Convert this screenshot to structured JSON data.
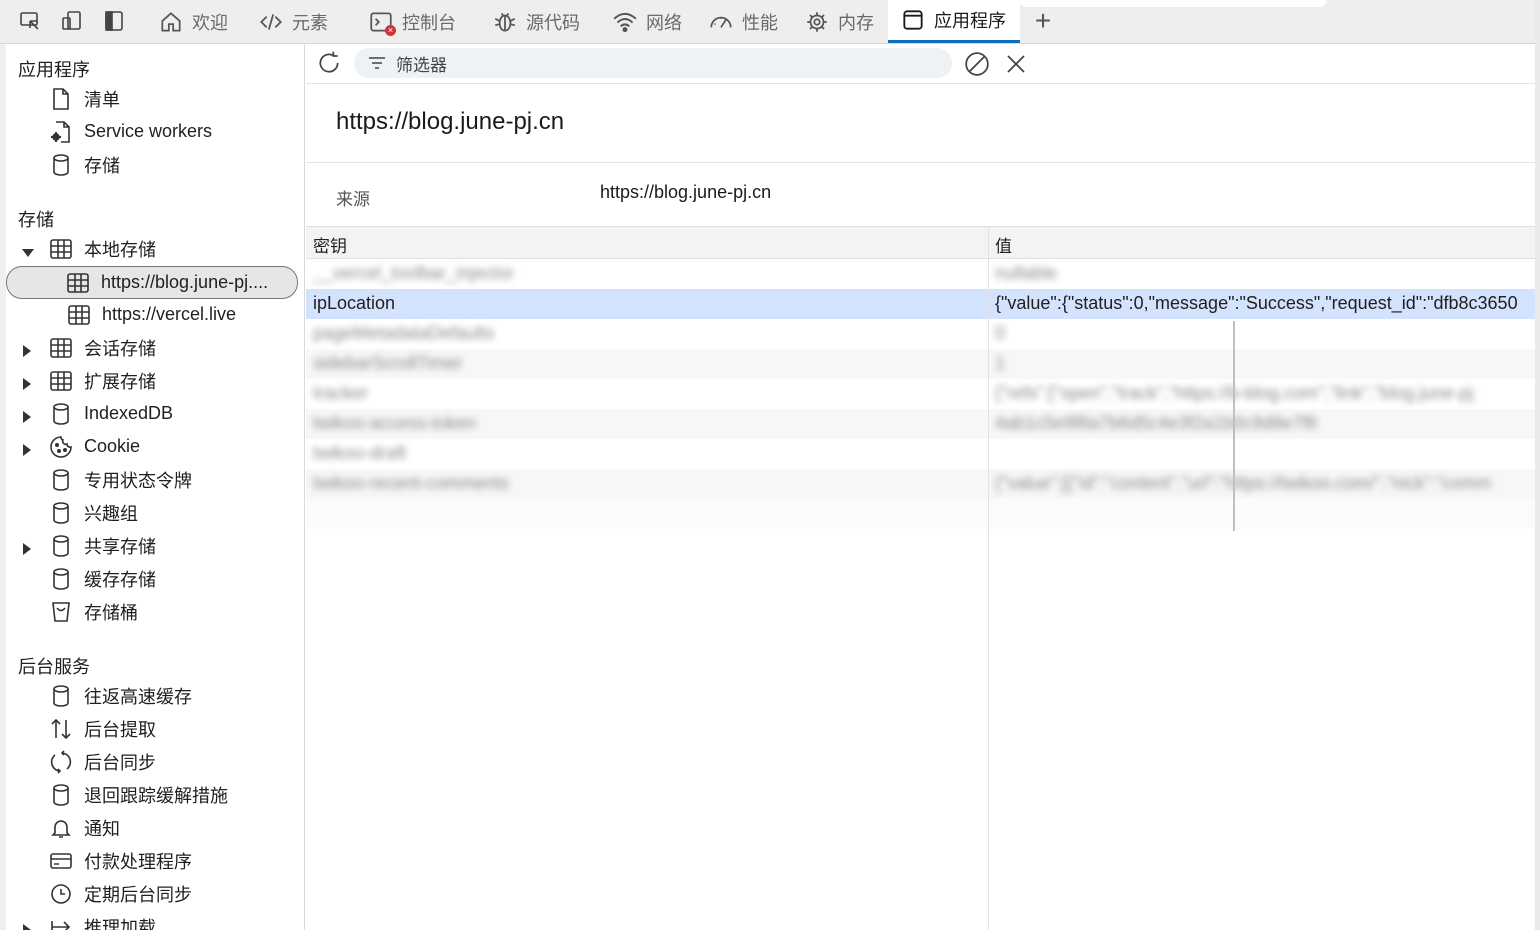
{
  "toolbar": {
    "tabs": [
      {
        "label": "欢迎",
        "icon": "home-icon"
      },
      {
        "label": "元素",
        "icon": "code-icon"
      },
      {
        "label": "控制台",
        "icon": "console-icon"
      },
      {
        "label": "源代码",
        "icon": "bug-icon"
      },
      {
        "label": "网络",
        "icon": "wifi-icon"
      },
      {
        "label": "性能",
        "icon": "gauge-icon"
      },
      {
        "label": "内存",
        "icon": "chip-icon"
      },
      {
        "label": "应用程序",
        "icon": "window-icon",
        "active": true
      }
    ],
    "error_badge": "×",
    "add_tab": "+"
  },
  "sidebar": {
    "sections": [
      {
        "title": "应用程序",
        "items": [
          {
            "label": "清单",
            "icon": "document-icon"
          },
          {
            "label": "Service workers",
            "icon": "gear-document-icon"
          },
          {
            "label": "存储",
            "icon": "database-icon"
          }
        ]
      },
      {
        "title": "存储",
        "items": [
          {
            "label": "本地存储",
            "icon": "table-icon",
            "expanded": true
          },
          {
            "label": "https://blog.june-pj....",
            "icon": "table-icon",
            "selected": true
          },
          {
            "label": "https://vercel.live",
            "icon": "table-icon"
          },
          {
            "label": "会话存储",
            "icon": "table-icon",
            "collapsed": true
          },
          {
            "label": "扩展存储",
            "icon": "table-icon",
            "collapsed": true
          },
          {
            "label": "IndexedDB",
            "icon": "database-icon",
            "collapsed": true
          },
          {
            "label": "Cookie",
            "icon": "cookie-icon",
            "collapsed": true
          },
          {
            "label": "专用状态令牌",
            "icon": "database-icon"
          },
          {
            "label": "兴趣组",
            "icon": "database-icon"
          },
          {
            "label": "共享存储",
            "icon": "database-icon",
            "collapsed": true
          },
          {
            "label": "缓存存储",
            "icon": "database-icon"
          },
          {
            "label": "存储桶",
            "icon": "bucket-icon"
          }
        ]
      },
      {
        "title": "后台服务",
        "items": [
          {
            "label": "往返高速缓存",
            "icon": "database-icon"
          },
          {
            "label": "后台提取",
            "icon": "arrows-updown-icon"
          },
          {
            "label": "后台同步",
            "icon": "sync-icon"
          },
          {
            "label": "退回跟踪缓解措施",
            "icon": "database-icon"
          },
          {
            "label": "通知",
            "icon": "bell-icon"
          },
          {
            "label": "付款处理程序",
            "icon": "card-icon"
          },
          {
            "label": "定期后台同步",
            "icon": "clock-icon"
          },
          {
            "label": "推理加载",
            "icon": "arrow-right-icon",
            "collapsed": true
          }
        ]
      }
    ]
  },
  "filter": {
    "placeholder": "筛选器"
  },
  "origin": {
    "title": "https://blog.june-pj.cn",
    "label": "来源",
    "value": "https://blog.june-pj.cn"
  },
  "grid": {
    "headers": {
      "key": "密钥",
      "value": "值"
    },
    "rows": [
      {
        "key": "__vercel_toolbar_injector",
        "value": "nullable",
        "blurred": true
      },
      {
        "key": "ipLocation",
        "value": "{\"value\":{\"status\":0,\"message\":\"Success\",\"request_id\":\"dfb8c3650",
        "selected": true
      },
      {
        "key": "pageMetadataDefaults",
        "value": "0",
        "blurred": true
      },
      {
        "key": "sidebarScrollTimer",
        "value": "1",
        "blurred": true
      },
      {
        "key": "tracker",
        "value": "{\"refs\":[\"open\",\"track\",\"https://b-blog.com\",\"link\",\"blog.june-pj",
        "blurred": true
      },
      {
        "key": "twikoo-access-token",
        "value": "4ab1c5e9f8a7b6d5c4e3f2a1b0c9d8e7f6",
        "blurred": true
      },
      {
        "key": "twikoo-draft",
        "value": "",
        "blurred": true
      },
      {
        "key": "twikoo-recent-comments",
        "value": "{\"value\":[{\"id\":\"content\",\"url\":\"https://twikoo.com/\",\"nick\":\"comm",
        "blurred": true
      }
    ]
  }
}
